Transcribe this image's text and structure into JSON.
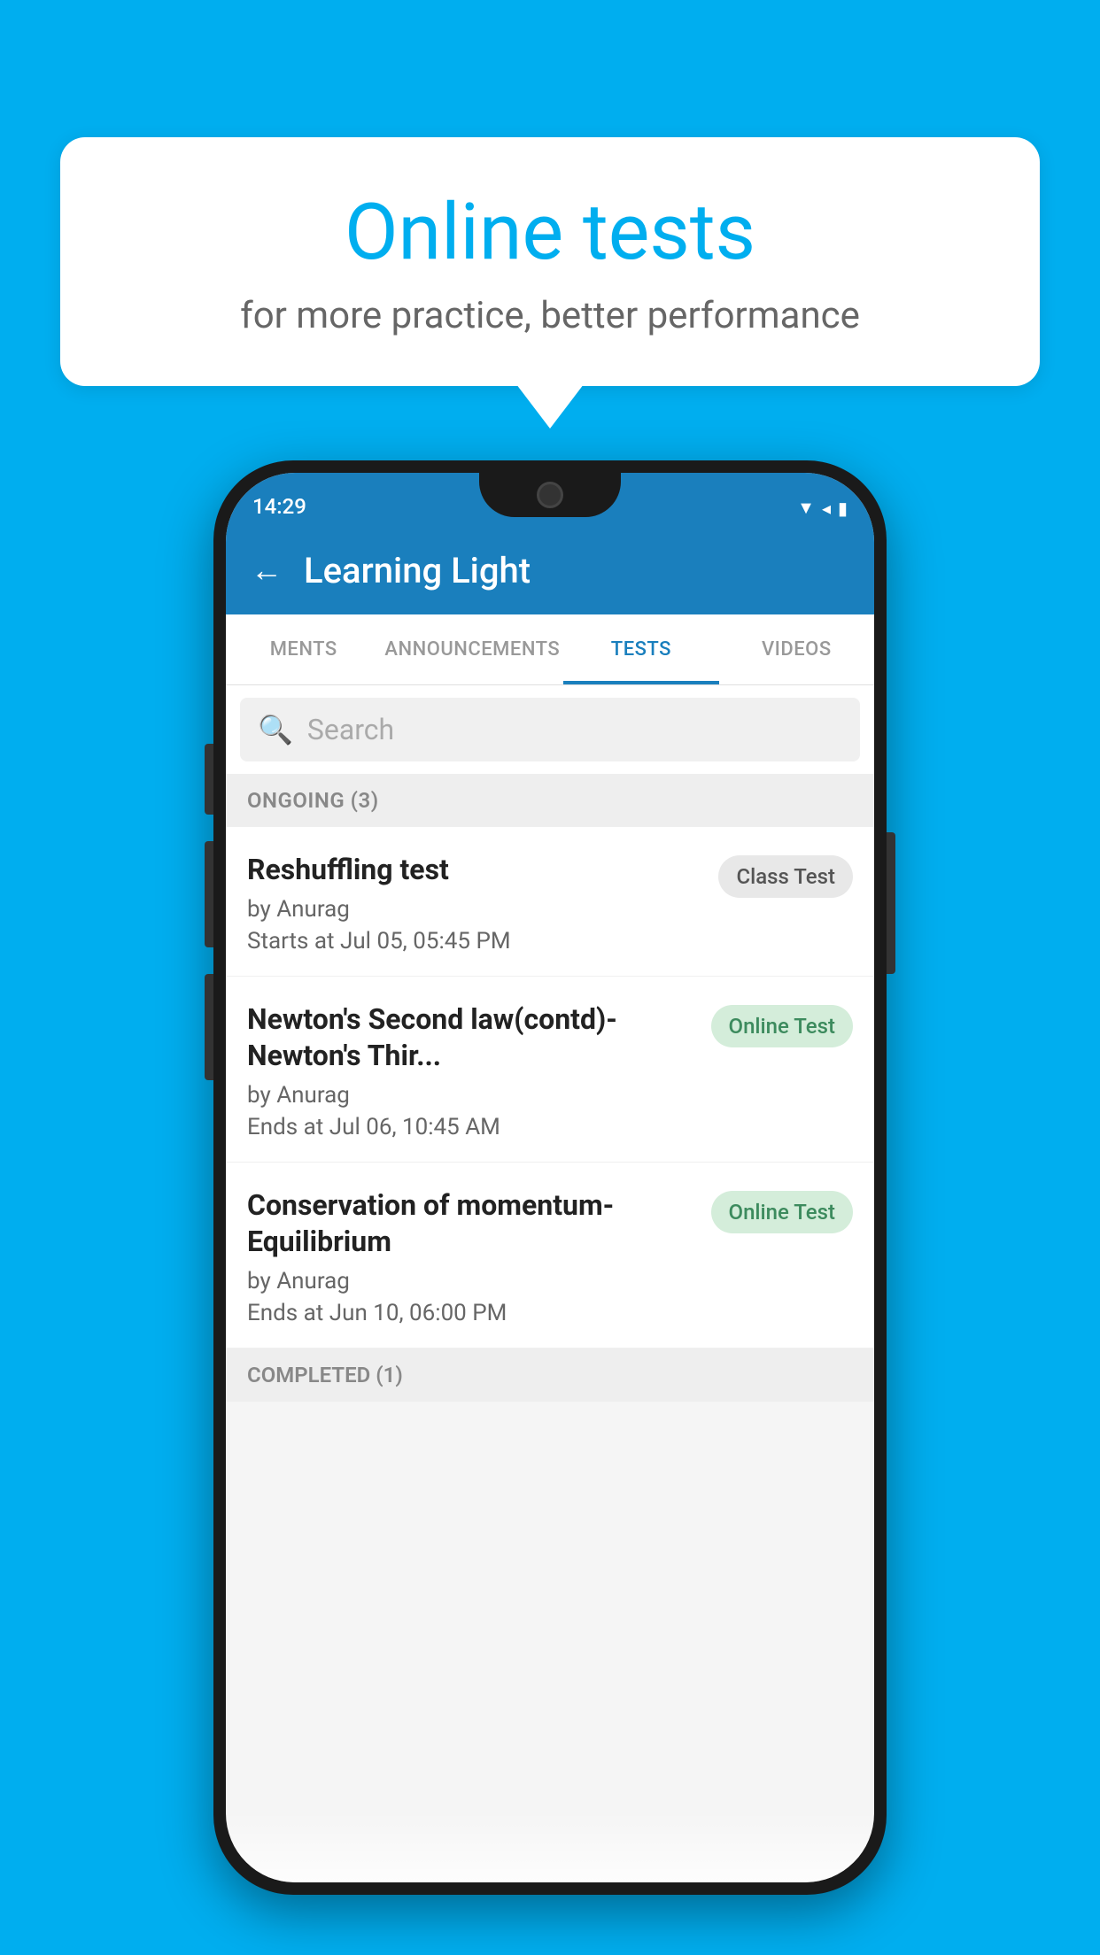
{
  "background_color": "#00AEEF",
  "bubble": {
    "title": "Online tests",
    "subtitle": "for more practice, better performance"
  },
  "phone": {
    "status_bar": {
      "time": "14:29",
      "icons": "▼◂▮"
    },
    "app_bar": {
      "back_label": "←",
      "title": "Learning Light"
    },
    "tabs": [
      {
        "label": "MENTS",
        "active": false
      },
      {
        "label": "ANNOUNCEMENTS",
        "active": false
      },
      {
        "label": "TESTS",
        "active": true
      },
      {
        "label": "VIDEOS",
        "active": false
      }
    ],
    "search": {
      "placeholder": "Search"
    },
    "ongoing_section": {
      "title": "ONGOING (3)"
    },
    "tests": [
      {
        "name": "Reshuffling test",
        "author": "by Anurag",
        "date": "Starts at  Jul 05, 05:45 PM",
        "badge": "Class Test",
        "badge_type": "class"
      },
      {
        "name": "Newton's Second law(contd)-Newton's Thir...",
        "author": "by Anurag",
        "date": "Ends at  Jul 06, 10:45 AM",
        "badge": "Online Test",
        "badge_type": "online"
      },
      {
        "name": "Conservation of momentum-Equilibrium",
        "author": "by Anurag",
        "date": "Ends at  Jun 10, 06:00 PM",
        "badge": "Online Test",
        "badge_type": "online"
      }
    ],
    "completed_section": {
      "title": "COMPLETED (1)"
    }
  }
}
